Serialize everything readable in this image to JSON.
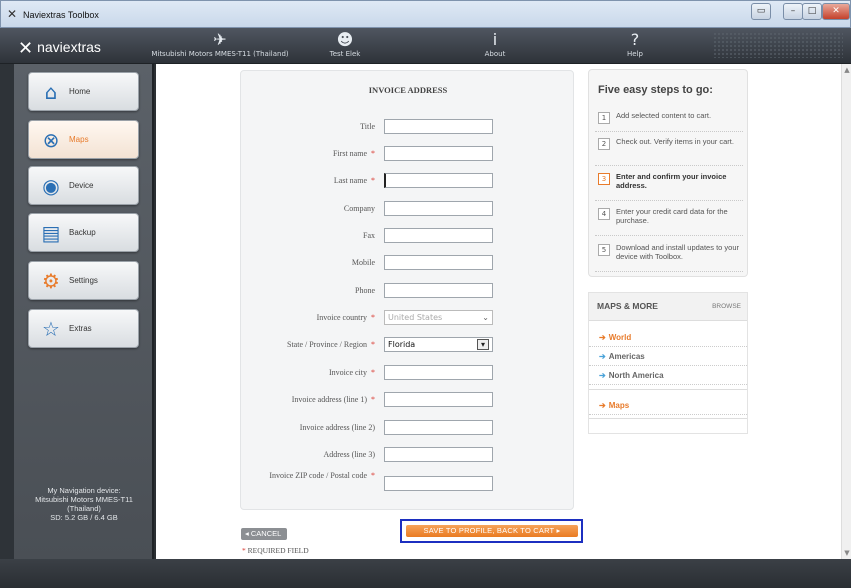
{
  "window": {
    "title": "Naviextras Toolbox",
    "controls": [
      "restore",
      "minimize",
      "maximize",
      "close"
    ]
  },
  "toolbar": {
    "brand": "naviextras",
    "items": [
      {
        "icon": "satellite-icon",
        "label": "Mitsubishi Motors MMES-T11 (Thailand)"
      },
      {
        "icon": "user-icon",
        "label": "Test Elek"
      },
      {
        "icon": "info-icon",
        "label": "About"
      },
      {
        "icon": "help-icon",
        "label": "Help"
      }
    ]
  },
  "sidebar": {
    "items": [
      {
        "label": "Home",
        "icon": "home-icon"
      },
      {
        "label": "Maps",
        "icon": "maps-icon"
      },
      {
        "label": "Device",
        "icon": "device-icon"
      },
      {
        "label": "Backup",
        "icon": "backup-icon"
      },
      {
        "label": "Settings",
        "icon": "gear-icon"
      },
      {
        "label": "Extras",
        "icon": "star-icon"
      }
    ],
    "active_index": 1,
    "device_info": [
      "My Navigation device:",
      "Mitsubishi Motors MMES-T11",
      "(Thailand)",
      "SD: 5.2 GB / 6.4 GB"
    ]
  },
  "form": {
    "title": "INVOICE ADDRESS",
    "fields": [
      {
        "label": "Title",
        "required": false,
        "value": ""
      },
      {
        "label": "First name",
        "required": true,
        "value": ""
      },
      {
        "label": "Last name",
        "required": true,
        "value": ""
      },
      {
        "label": "Company",
        "required": false,
        "value": ""
      },
      {
        "label": "Fax",
        "required": false,
        "value": ""
      },
      {
        "label": "Mobile",
        "required": false,
        "value": ""
      },
      {
        "label": "Phone",
        "required": false,
        "value": ""
      },
      {
        "label": "Invoice country",
        "required": true,
        "value": "United States",
        "type": "select",
        "disabled": true
      },
      {
        "label": "State / Province / Region",
        "required": true,
        "value": "Florida",
        "type": "select",
        "disabled": false
      },
      {
        "label": "Invoice city",
        "required": true,
        "value": ""
      },
      {
        "label": "Invoice address (line 1)",
        "required": true,
        "value": ""
      },
      {
        "label": "Invoice address (line 2)",
        "required": false,
        "value": ""
      },
      {
        "label": "Address (line 3)",
        "required": false,
        "value": ""
      },
      {
        "label": "Invoice ZIP code / Postal code",
        "required": true,
        "value": ""
      }
    ],
    "cancel_label": "CANCEL",
    "save_label": "SAVE TO PROFILE, BACK TO CART",
    "required_note": "REQUIRED FIELD",
    "required_star": "*"
  },
  "steps": {
    "title": "Five easy steps to go:",
    "items": [
      {
        "num": "1",
        "text": "Add selected content to cart."
      },
      {
        "num": "2",
        "text": "Check out. Verify items in your cart."
      },
      {
        "num": "3",
        "text": "Enter and confirm your invoice address.",
        "active": true
      },
      {
        "num": "4",
        "text": "Enter your credit card data for the purchase."
      },
      {
        "num": "5",
        "text": "Download and install updates to your device with Toolbox."
      }
    ]
  },
  "maps_more": {
    "title": "MAPS & MORE",
    "browse": "BROWSE",
    "links": [
      {
        "label": "World",
        "style": "orange"
      },
      {
        "label": "Americas",
        "style": "blue"
      },
      {
        "label": "North America",
        "style": "blue"
      },
      {
        "label": "Maps",
        "style": "orange"
      }
    ]
  }
}
